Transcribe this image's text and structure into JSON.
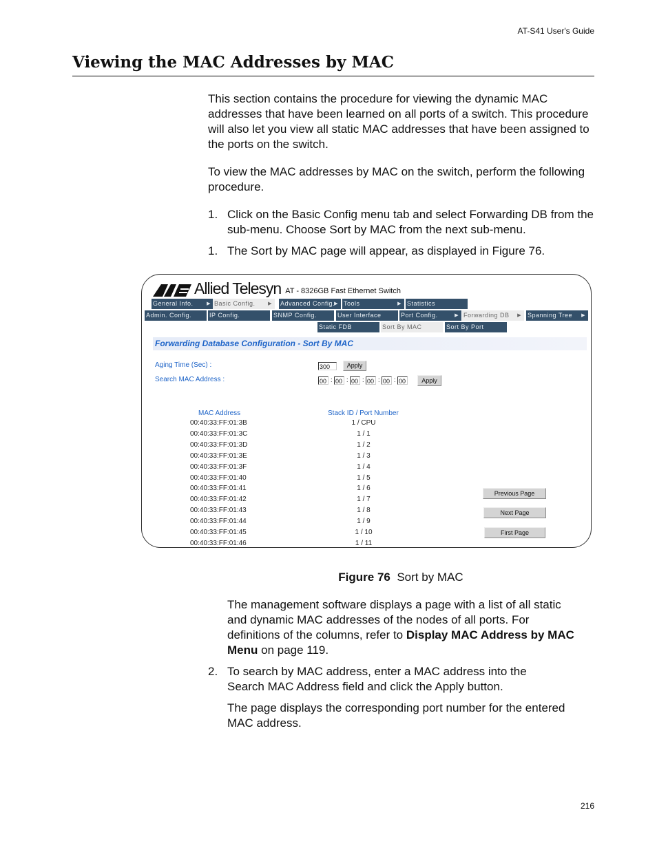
{
  "header": "AT-S41 User's Guide",
  "title": "Viewing the MAC Addresses by MAC",
  "intro": [
    "This section contains the procedure for viewing the dynamic MAC addresses that have been learned on all ports of a switch. This procedure will also let you view all static MAC addresses that have been assigned to the ports on the switch.",
    "To view the MAC addresses by MAC on the switch, perform the following procedure."
  ],
  "steps": [
    {
      "num": "1.",
      "text": "Click on the Basic Config menu tab and select Forwarding DB from the sub-menu. Choose Sort by MAC from the next sub-menu."
    },
    {
      "num": "1.",
      "text": "The Sort by MAC page will appear, as displayed in Figure 76."
    }
  ],
  "figure": {
    "brand": "Allied Telesyn",
    "model": "AT - 8326GB Fast Ethernet Switch",
    "menu1": [
      {
        "label": "General Info.",
        "arrow": "▶"
      },
      {
        "label": "Basic Config.",
        "arrow": "▶",
        "selected": true
      },
      {
        "label": "Advanced Config.",
        "arrow": "▶"
      },
      {
        "label": "Tools",
        "arrow": "▶"
      },
      {
        "label": "Statistics"
      }
    ],
    "menu2": [
      {
        "label": "Admin. Config."
      },
      {
        "label": "IP Config."
      },
      {
        "label": "SNMP Config."
      },
      {
        "label": "User Interface"
      },
      {
        "label": "Port Config.",
        "arrow": "▶"
      },
      {
        "label": "Forwarding DB",
        "arrow": "▶",
        "selected": true
      },
      {
        "label": "Spanning Tree",
        "arrow": "▶"
      }
    ],
    "menu3": [
      {
        "label": "Static FDB"
      },
      {
        "label": "Sort By MAC",
        "selected": true
      },
      {
        "label": "Sort By Port"
      }
    ],
    "page_title": "Forwarding Database Configuration - Sort By MAC",
    "aging_label": "Aging Time (Sec) :",
    "aging_value": "300",
    "apply": "Apply",
    "search_label": "Search MAC Address :",
    "search_octets": [
      "00",
      "00",
      "00",
      "00",
      "00",
      "00"
    ],
    "col_mac": "MAC Address",
    "col_port": "Stack ID / Port Number",
    "rows": [
      [
        "00:40:33:FF:01:3B",
        "1 / CPU"
      ],
      [
        "00:40:33:FF:01:3C",
        "1 / 1"
      ],
      [
        "00:40:33:FF:01:3D",
        "1 / 2"
      ],
      [
        "00:40:33:FF:01:3E",
        "1 / 3"
      ],
      [
        "00:40:33:FF:01:3F",
        "1 / 4"
      ],
      [
        "00:40:33:FF:01:40",
        "1 / 5"
      ],
      [
        "00:40:33:FF:01:41",
        "1 / 6"
      ],
      [
        "00:40:33:FF:01:42",
        "1 / 7"
      ],
      [
        "00:40:33:FF:01:43",
        "1 / 8"
      ],
      [
        "00:40:33:FF:01:44",
        "1 / 9"
      ],
      [
        "00:40:33:FF:01:45",
        "1 / 10"
      ],
      [
        "00:40:33:FF:01:46",
        "1 / 11"
      ]
    ],
    "prev": "Previous Page",
    "next": "Next Page",
    "first": "First Page",
    "colors": {
      "menu": "#34506a",
      "accent": "#1e64c8"
    }
  },
  "caption": {
    "label": "Figure 76",
    "text": "Sort by MAC"
  },
  "after1": {
    "a": "The management software displays a page with a list of all static and dynamic MAC addresses of the nodes of all ports. For definitions of the columns, refer to ",
    "b": "Display MAC Address by MAC Menu",
    "c": " on page 119."
  },
  "step2": {
    "num": "2.",
    "text": "To search by MAC address, enter a MAC address into the Search MAC Address field and click the Apply button."
  },
  "after2": "The page displays the corresponding port number for the entered MAC address.",
  "page_number": "216"
}
